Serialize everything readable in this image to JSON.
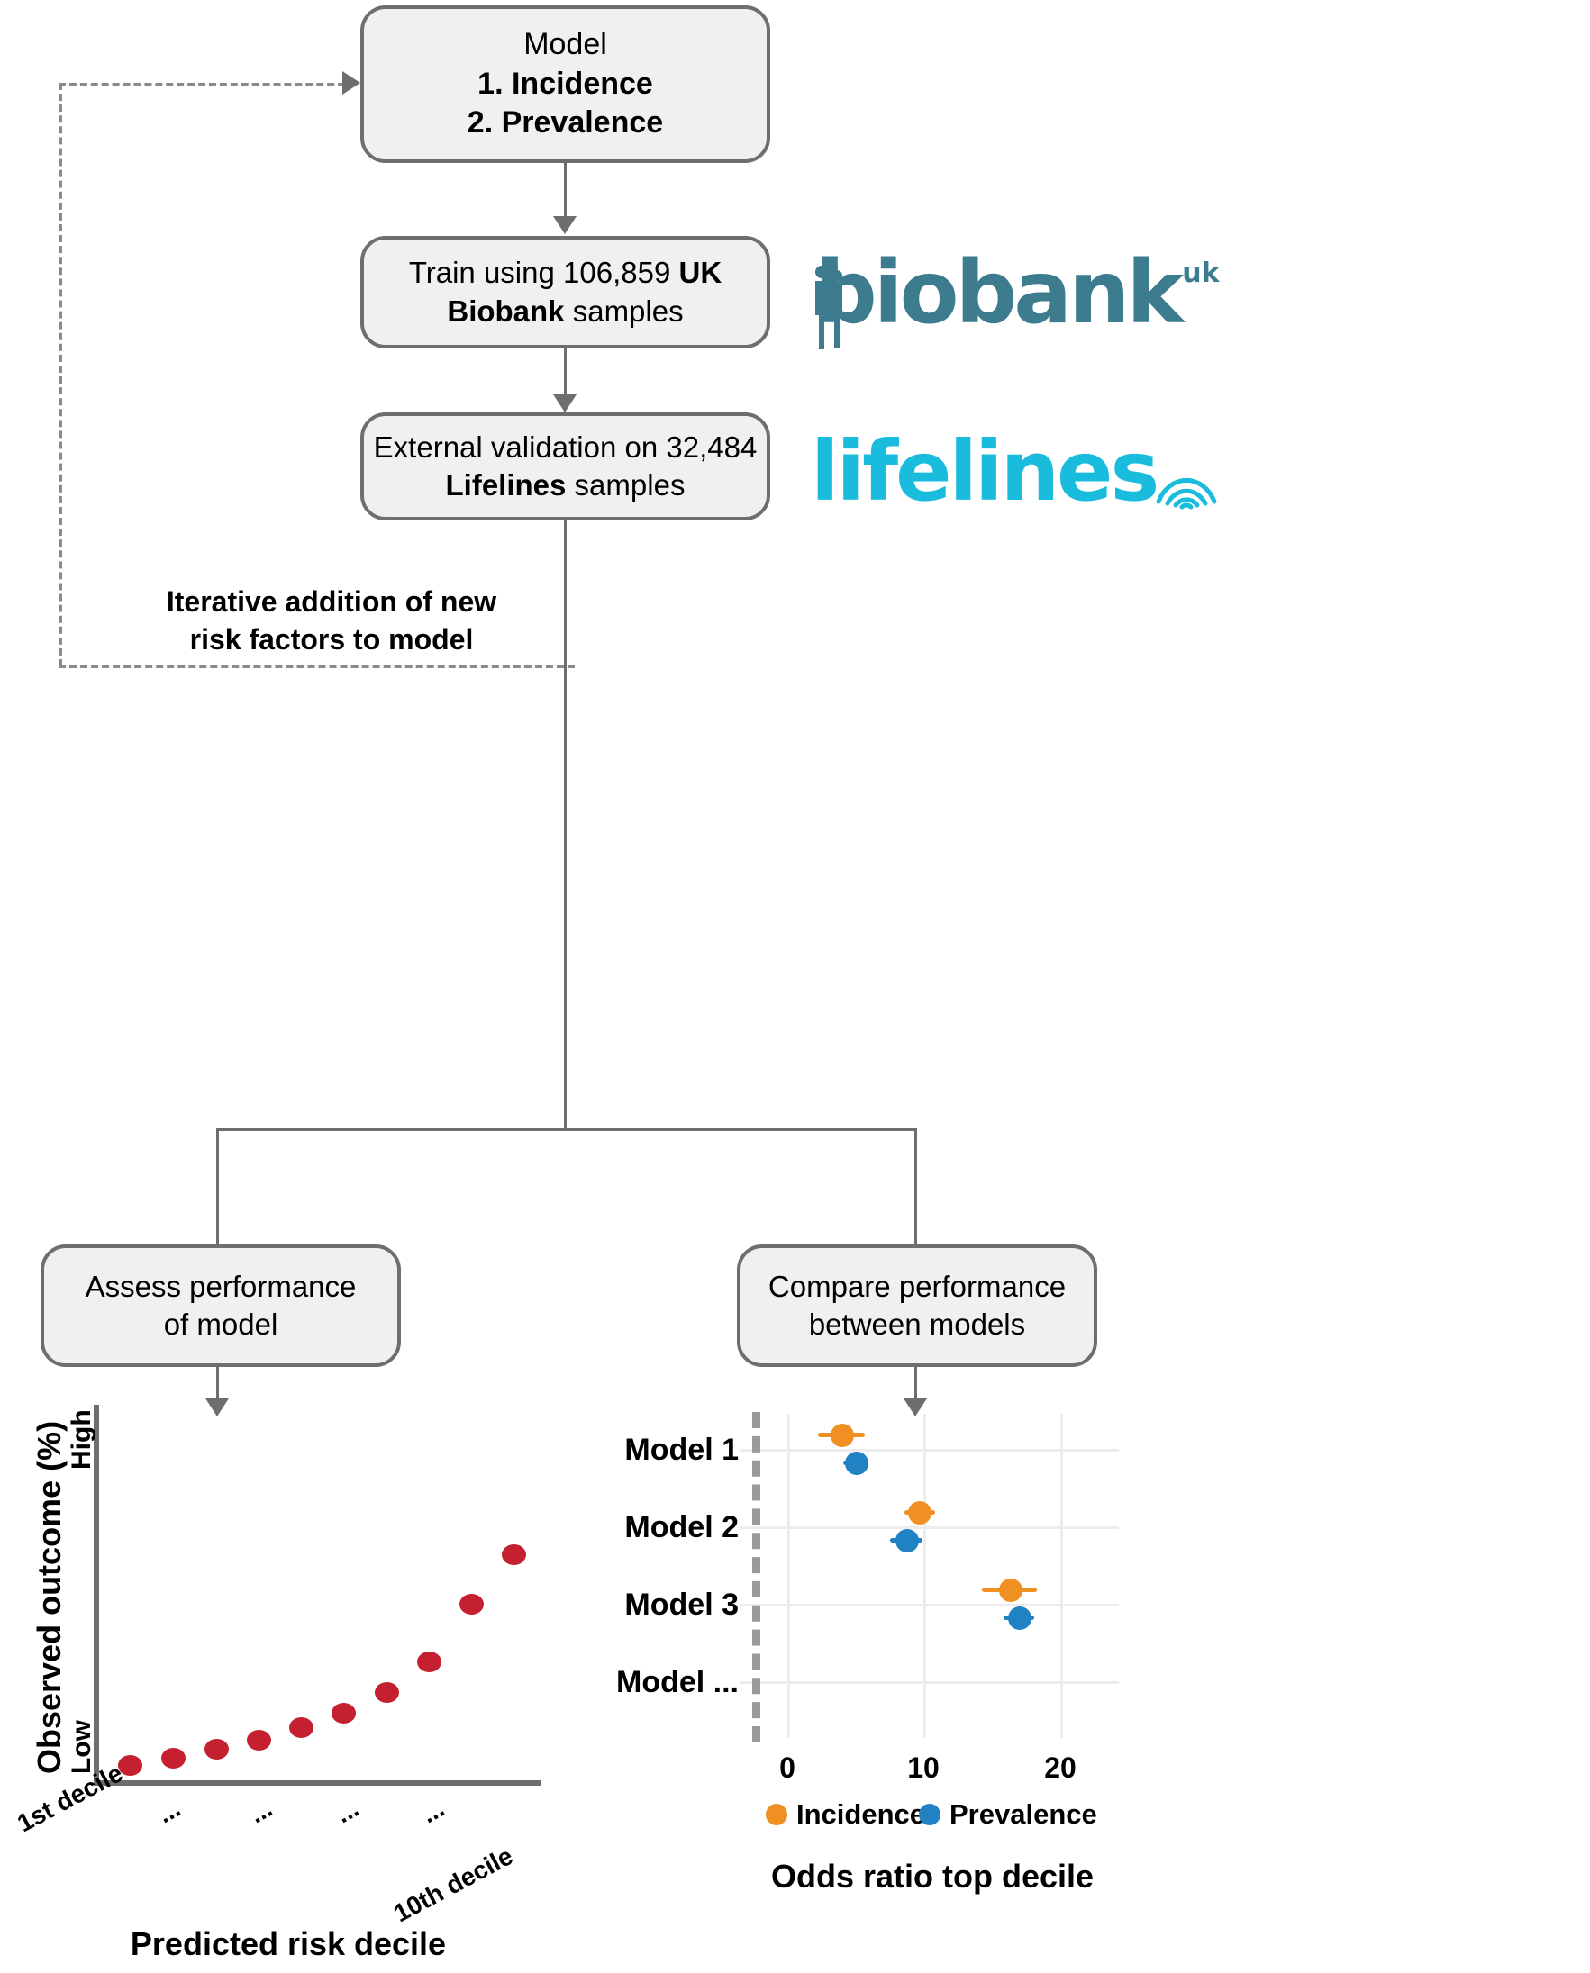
{
  "figure": {
    "type": "flow-diagram-with-plots",
    "background_color": "#ffffff"
  },
  "flow": {
    "box_fill": "#f0f0f0",
    "box_border": "#6e6e6e",
    "boxes": [
      {
        "id": "model-box",
        "lines": [
          "Model",
          "1. Incidence",
          "2. Prevalence"
        ],
        "bold_lines": [
          false,
          true,
          true
        ]
      },
      {
        "id": "train-box",
        "line1_pre": "Train using 106,859 ",
        "line1_bold": "UK",
        "line2_bold": "Biobank",
        "line2_post": " samples"
      },
      {
        "id": "validate-box",
        "line1_pre": "External validation on 32,484",
        "line2_bold": "Lifelines",
        "line2_post": " samples"
      },
      {
        "id": "assess-box",
        "lines": [
          "Assess performance",
          "of model"
        ]
      },
      {
        "id": "compare-box",
        "lines": [
          "Compare performance",
          "between models"
        ]
      }
    ],
    "iterative_label": {
      "line1": "Iterative addition of new",
      "line2": "risk factors to model"
    }
  },
  "logos": {
    "biobank": {
      "word": "biobank",
      "superscript": "uk",
      "color": "#3d7b8e"
    },
    "lifelines": {
      "word": "lifelines",
      "color": "#19bcdd"
    }
  },
  "chart_data": [
    {
      "id": "calibration-scatter",
      "type": "scatter",
      "title": "",
      "xlabel": "Predicted risk decile",
      "ylabel": "Observed outcome (%)",
      "ytick_labels": [
        "Low",
        "High"
      ],
      "xtick_labels": [
        "1st decile",
        "...",
        "...",
        "...",
        "...",
        "10th decile"
      ],
      "categories": [
        1,
        2,
        3,
        4,
        5,
        6,
        7,
        8,
        9,
        10
      ],
      "values": [
        6,
        8,
        11,
        14,
        18,
        23,
        28,
        36,
        52,
        68
      ],
      "ylim": [
        0,
        100
      ],
      "grid": false,
      "marker_color": "#c4202f",
      "legend_position": "none"
    },
    {
      "id": "odds-ratio-forest",
      "type": "scatter",
      "title": "",
      "xlabel": "Odds ratio top decile",
      "ylabel": "",
      "categories": [
        "Model 1",
        "Model 2",
        "Model 3",
        "Model ..."
      ],
      "xtick_labels": [
        "0",
        "10",
        "20"
      ],
      "xticks": [
        0,
        10,
        20
      ],
      "xlim": [
        -2.5,
        26
      ],
      "grid": true,
      "legend_position": "bottom",
      "series": [
        {
          "name": "Incidence",
          "color": "#f09022",
          "values": [
            4.0,
            9.4,
            16.2,
            null
          ],
          "ci_low": [
            2.6,
            8.6,
            14.2,
            null
          ],
          "ci_high": [
            6.0,
            10.8,
            18.2,
            null
          ]
        },
        {
          "name": "Prevalence",
          "color": "#2081c3",
          "values": [
            5.3,
            8.8,
            17.0,
            null
          ],
          "ci_low": [
            4.5,
            7.6,
            15.9,
            null
          ],
          "ci_high": [
            6.2,
            10.0,
            18.1,
            null
          ]
        }
      ]
    }
  ]
}
